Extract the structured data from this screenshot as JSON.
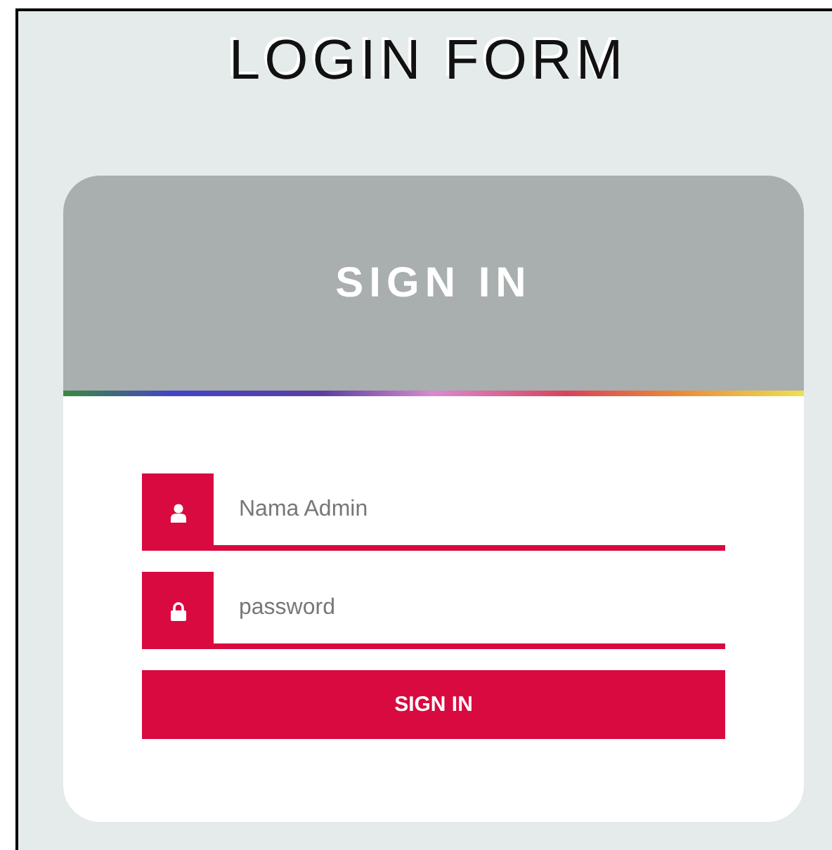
{
  "page_title": "LOGIN FORM",
  "card": {
    "heading": "SIGN IN",
    "fields": [
      {
        "kind": "text",
        "placeholder": "Nama Admin"
      },
      {
        "kind": "password",
        "placeholder": "password"
      }
    ],
    "button": "SIGN IN"
  }
}
